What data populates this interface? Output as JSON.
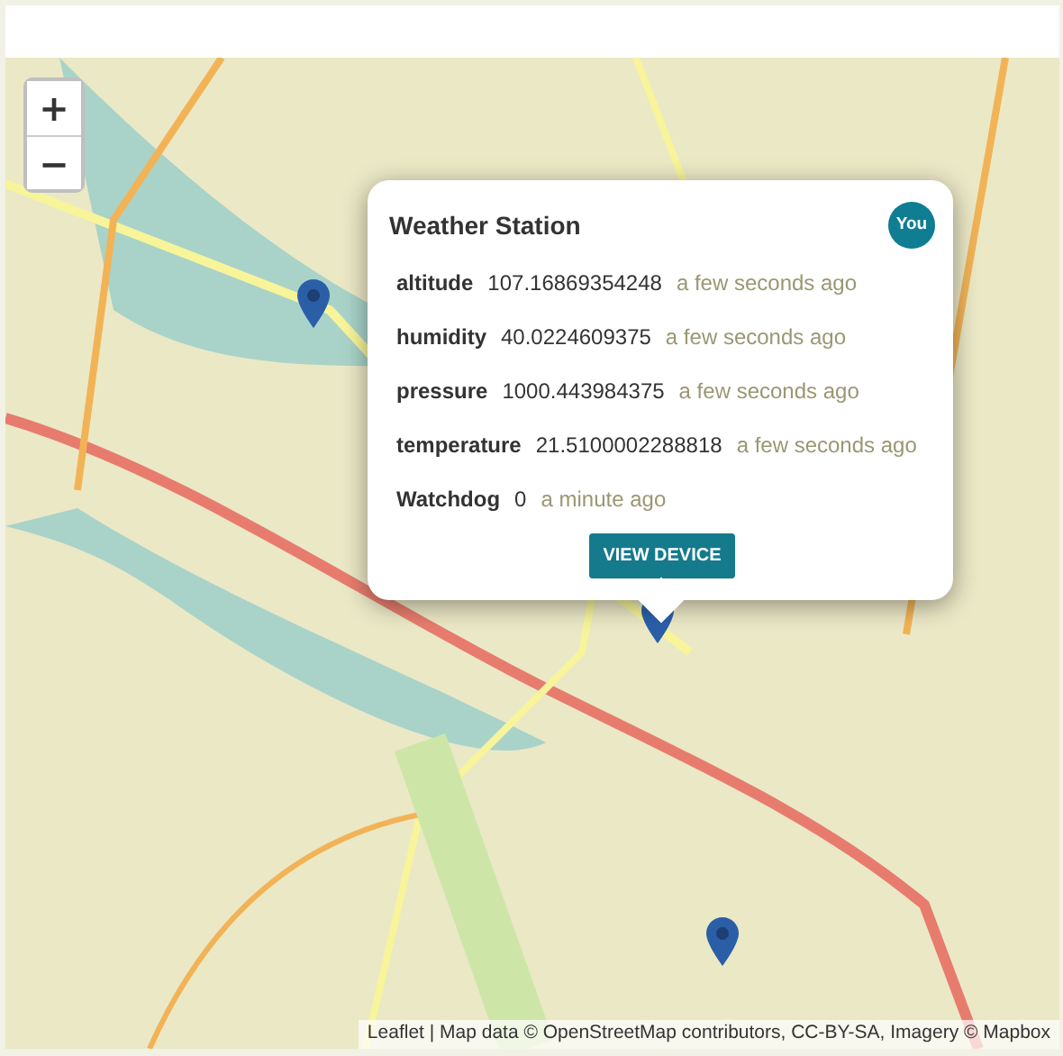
{
  "map": {
    "zoom_in": "+",
    "zoom_out": "−",
    "popup": {
      "title": "Weather Station",
      "badge": "You",
      "readings": [
        {
          "name": "altitude",
          "value": "107.16869354248",
          "time": "a few seconds ago"
        },
        {
          "name": "humidity",
          "value": "40.0224609375",
          "time": "a few seconds ago"
        },
        {
          "name": "pressure",
          "value": "1000.443984375",
          "time": "a few seconds ago"
        },
        {
          "name": "temperature",
          "value": "21.5100002288818",
          "time": "a few seconds ago"
        },
        {
          "name": "Watchdog",
          "value": "0",
          "time": "a minute ago"
        }
      ],
      "button": "VIEW DEVICE"
    },
    "attribution": "Leaflet | Map data © OpenStreetMap contributors, CC-BY-SA, Imagery © Mapbox"
  }
}
